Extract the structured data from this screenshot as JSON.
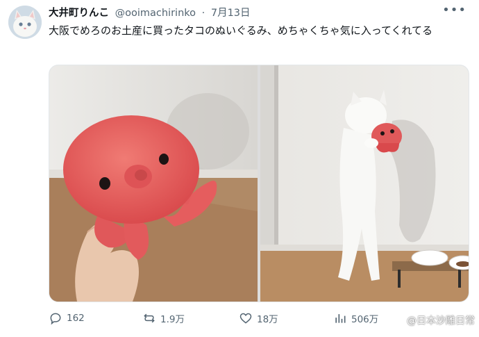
{
  "tweet": {
    "display_name": "大井町りんこ",
    "handle": "@ooimachirinko",
    "separator": "·",
    "date": "7月13日",
    "text": "大阪でめろのお土産に買ったタコのぬいぐるみ、めちゃくちゃ気に入ってくれてる",
    "more_icon": "more-dots-icon"
  },
  "media": {
    "images": [
      {
        "description": "hand-holding-octopus-plush"
      },
      {
        "description": "white-cat-hugging-octopus-plush"
      }
    ]
  },
  "actions": {
    "replies": "162",
    "retweets": "1.9万",
    "likes": "18万",
    "views": "506万"
  },
  "watermark": {
    "text": "@日本沙雕日常",
    "logo": "weibo-logo"
  },
  "colors": {
    "text_primary": "#0f1419",
    "text_secondary": "#536471",
    "octopus_plush": "#e65b5b"
  }
}
